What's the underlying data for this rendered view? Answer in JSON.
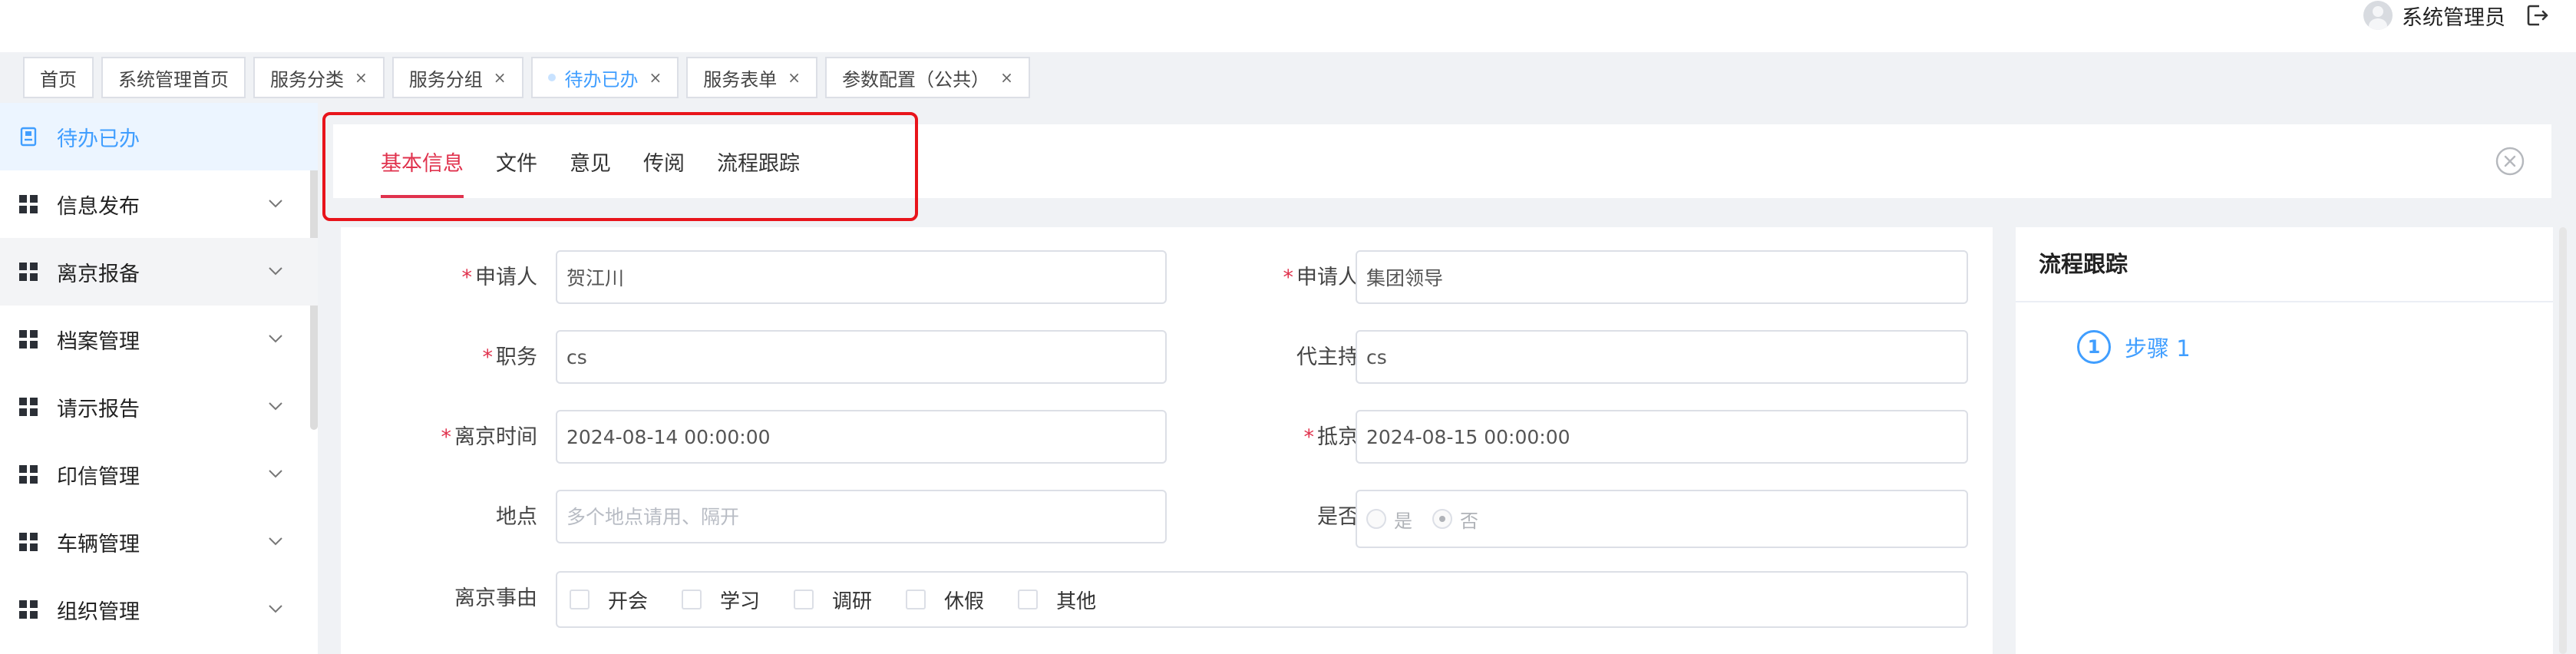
{
  "header": {
    "user_name": "系统管理员",
    "icons": {
      "avatar": "user-avatar-icon",
      "logout": "logout-icon"
    }
  },
  "page_tabs": [
    {
      "label": "首页",
      "closable": false,
      "active": false
    },
    {
      "label": "系统管理首页",
      "closable": false,
      "active": false
    },
    {
      "label": "服务分类",
      "closable": true,
      "active": false
    },
    {
      "label": "服务分组",
      "closable": true,
      "active": false
    },
    {
      "label": "待办已办",
      "closable": true,
      "active": true
    },
    {
      "label": "服务表单",
      "closable": true,
      "active": false
    },
    {
      "label": "参数配置（公共）",
      "closable": true,
      "active": false
    }
  ],
  "tab_close_glyph": "×",
  "sidebar": {
    "items": [
      {
        "label": "待办已办",
        "icon": "document-icon",
        "active": true,
        "expandable": false
      },
      {
        "label": "信息发布",
        "icon": "grid-icon",
        "active": false,
        "expandable": true
      },
      {
        "label": "离京报备",
        "icon": "grid-icon",
        "active": false,
        "expandable": true
      },
      {
        "label": "档案管理",
        "icon": "grid-icon",
        "active": false,
        "expandable": true
      },
      {
        "label": "请示报告",
        "icon": "grid-icon",
        "active": false,
        "expandable": true
      },
      {
        "label": "印信管理",
        "icon": "grid-icon",
        "active": false,
        "expandable": true
      },
      {
        "label": "车辆管理",
        "icon": "grid-icon",
        "active": false,
        "expandable": true
      },
      {
        "label": "组织管理",
        "icon": "grid-icon",
        "active": false,
        "expandable": true
      }
    ]
  },
  "inner_tabs": [
    {
      "label": "基本信息",
      "active": true
    },
    {
      "label": "文件",
      "active": false
    },
    {
      "label": "意见",
      "active": false
    },
    {
      "label": "传阅",
      "active": false
    },
    {
      "label": "流程跟踪",
      "active": false
    }
  ],
  "form": {
    "applicant": {
      "label": "申请人",
      "required": true,
      "value": "贺江川"
    },
    "applicant_dept": {
      "label": "申请人部门",
      "required": true,
      "value": "集团领导"
    },
    "position": {
      "label": "职务",
      "required": true,
      "value": "cs"
    },
    "acting": {
      "label": "代主持工作",
      "required": false,
      "value": "cs"
    },
    "leave_time": {
      "label": "离京时间",
      "required": true,
      "value": "2024-08-14 00:00:00"
    },
    "arrive_time": {
      "label": "抵京时间",
      "required": true,
      "value": "2024-08-15 00:00:00"
    },
    "location": {
      "label": "地点",
      "required": false,
      "value": "",
      "placeholder": "多个地点请用、隔开"
    },
    "leave_beijing": {
      "label": "是否离京",
      "required": false,
      "options": [
        "是",
        "否"
      ],
      "selected": "否"
    },
    "reason": {
      "label": "离京事由",
      "required": false,
      "options": [
        "开会",
        "学习",
        "调研",
        "休假",
        "其他"
      ]
    },
    "required_mark": "*"
  },
  "flow_panel": {
    "title": "流程跟踪",
    "steps": [
      {
        "number": "1",
        "label": "步骤 1"
      }
    ]
  },
  "colors": {
    "accent": "#409eff",
    "active_tab": "#e0324d",
    "highlight_box": "#e8141b",
    "background": "#f0f2f5"
  }
}
